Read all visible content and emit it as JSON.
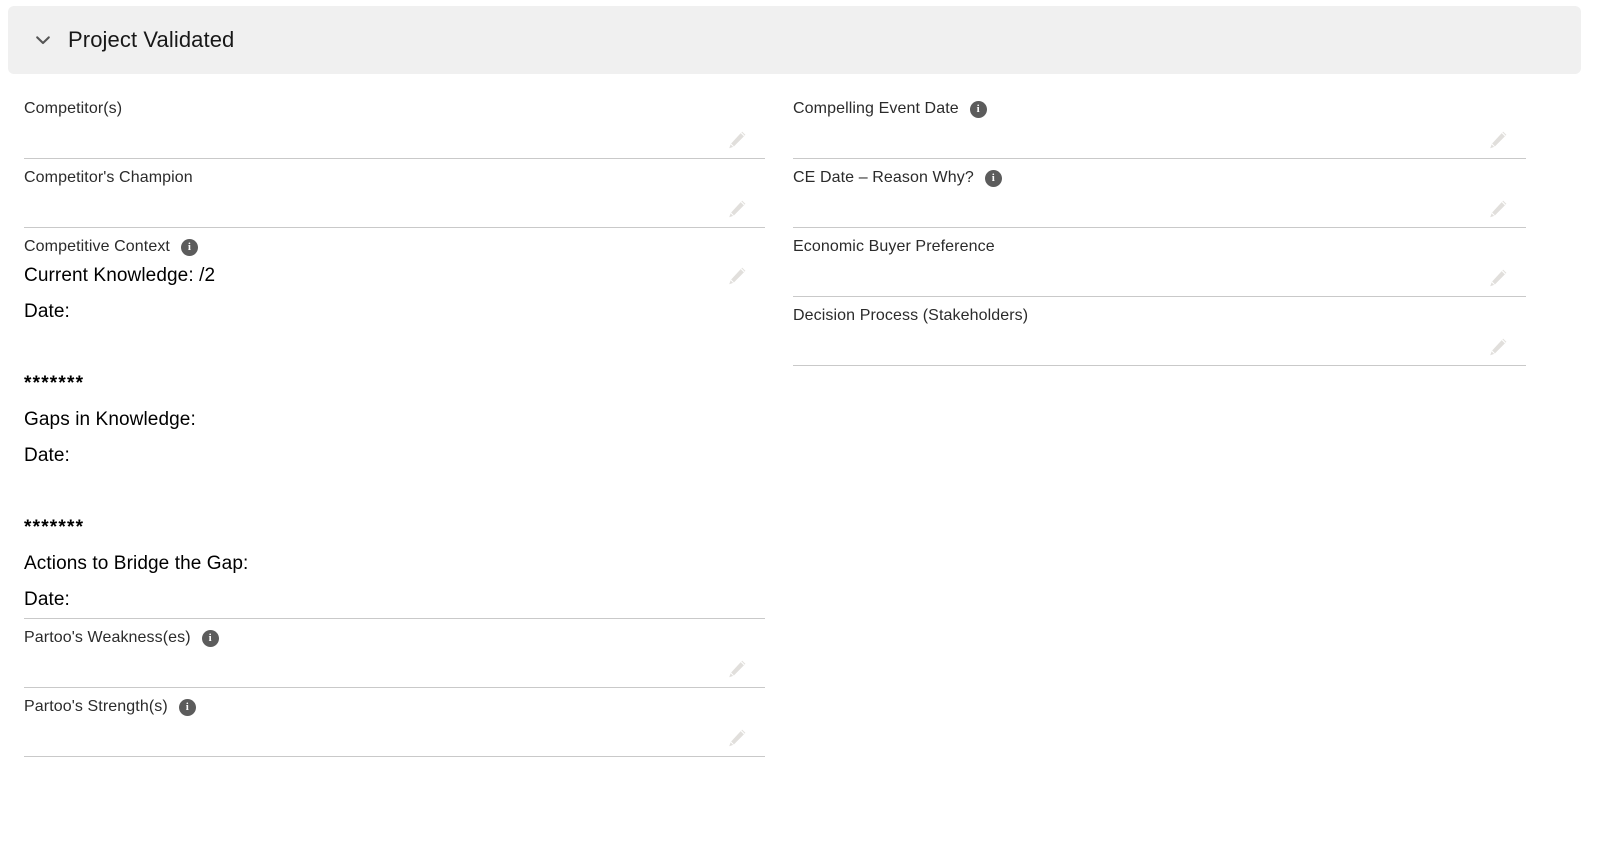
{
  "section": {
    "title": "Project Validated",
    "expanded": true,
    "chevron_icon": "chevron-down-icon",
    "header_bg": "#f0f0f0"
  },
  "icons": {
    "info": "info-icon",
    "edit": "pencil-icon",
    "info_glyph": "i"
  },
  "colors": {
    "header_background": "#f0f0f0",
    "divider": "#c9c9c9",
    "label_text": "#2b2b2b",
    "value_text": "#000000",
    "info_badge": "#5c5c5c",
    "pencil": "#dcdad6"
  },
  "left_column": [
    {
      "label": "Competitor(s)",
      "has_info": false,
      "value": ""
    },
    {
      "label": "Competitor's Champion",
      "has_info": false,
      "value": ""
    },
    {
      "label": "Competitive Context",
      "has_info": true,
      "value": "Current Knowledge: /2\nDate:\n\n*******\nGaps in Knowledge:\nDate:\n\n*******\nActions to Bridge the Gap:\nDate:"
    },
    {
      "label": "Partoo's Weakness(es)",
      "has_info": true,
      "value": ""
    },
    {
      "label": "Partoo's Strength(s)",
      "has_info": true,
      "value": ""
    }
  ],
  "right_column": [
    {
      "label": "Compelling Event Date",
      "has_info": true,
      "value": ""
    },
    {
      "label": "CE Date – Reason Why?",
      "has_info": true,
      "value": ""
    },
    {
      "label": "Economic Buyer Preference",
      "has_info": false,
      "value": ""
    },
    {
      "label": "Decision Process (Stakeholders)",
      "has_info": false,
      "value": ""
    }
  ]
}
